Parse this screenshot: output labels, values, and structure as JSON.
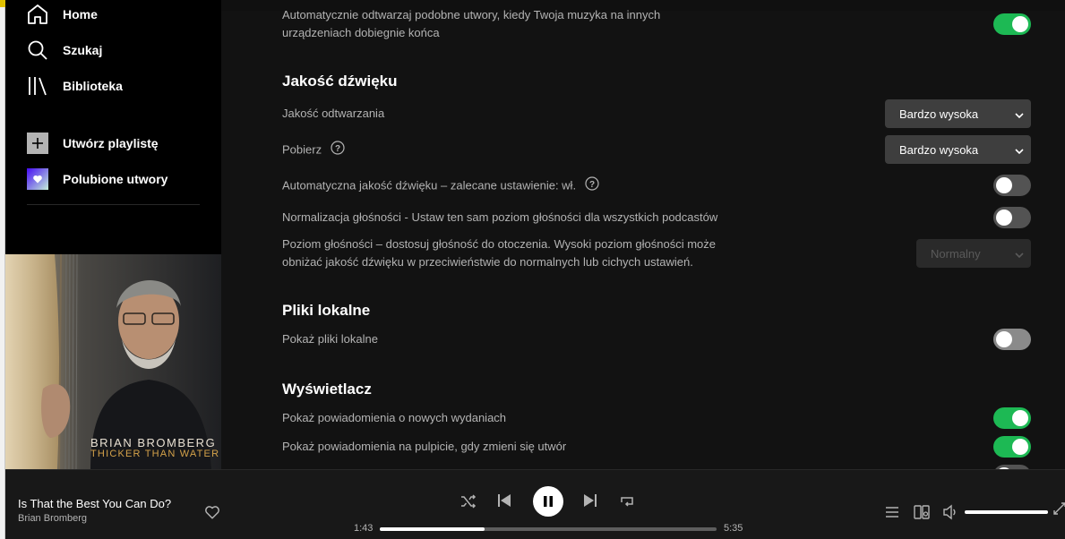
{
  "sidebar": {
    "items": [
      {
        "label": "Home",
        "icon": "home-icon"
      },
      {
        "label": "Szukaj",
        "icon": "search-icon"
      },
      {
        "label": "Biblioteka",
        "icon": "library-icon"
      }
    ],
    "create_playlist": {
      "label": "Utwórz playlistę",
      "icon": "plus-icon"
    },
    "liked_songs": {
      "label": "Polubione utwory",
      "icon": "heart-icon"
    }
  },
  "cover": {
    "artist": "BRIAN BROMBERG",
    "album": "THICKER THAN WATER"
  },
  "settings": {
    "autoplay": {
      "line1": "Automatycznie odtwarzaj podobne utwory, kiedy Twoja muzyka na innych",
      "line2": "urządzeniach dobiegnie końca",
      "enabled": true
    },
    "audio_quality": {
      "title": "Jakość dźwięku",
      "streaming_label": "Jakość odtwarzania",
      "streaming_value": "Bardzo wysoka",
      "download_label": "Pobierz",
      "download_value": "Bardzo wysoka",
      "auto_quality_label": "Automatyczna jakość dźwięku – zalecane ustawienie: wł.",
      "auto_quality_enabled": false,
      "normalize_label": "Normalizacja głośności - Ustaw ten sam poziom głośności dla wszystkich podcastów",
      "normalize_enabled": false,
      "volume_level_line1": "Poziom głośności – dostosuj głośność do otoczenia. Wysoki poziom głośności może",
      "volume_level_line2": "obniżać jakość dźwięku w przeciwieństwie do normalnych lub cichych ustawień.",
      "volume_level_value": "Normalny"
    },
    "local_files": {
      "title": "Pliki lokalne",
      "show_label": "Pokaż pliki lokalne",
      "enabled": false
    },
    "display": {
      "title": "Wyświetlacz",
      "new_releases_label": "Pokaż powiadomienia o nowych wydaniach",
      "new_releases_enabled": true,
      "desktop_notif_label": "Pokaż powiadomienia na pulpicie, gdy zmieni się utwór",
      "desktop_notif_enabled": true
    }
  },
  "player": {
    "track_title": "Is That the Best You Can Do?",
    "track_artist": "Brian Bromberg",
    "elapsed": "1:43",
    "duration": "5:35",
    "progress_fraction": 0.31,
    "volume_fraction": 1.0,
    "is_playing": true
  },
  "colors": {
    "accent": "#1db954",
    "background": "#121212",
    "sidebar": "#000000",
    "player": "#181818"
  }
}
